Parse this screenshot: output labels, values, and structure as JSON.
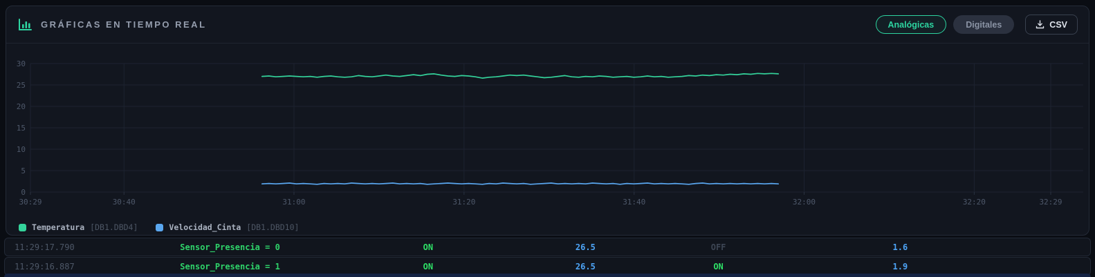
{
  "header": {
    "title": "GRÁFICAS EN TIEMPO REAL",
    "analog_button": "Analógicas",
    "digital_button": "Digitales",
    "csv_button": "CSV"
  },
  "colors": {
    "accent_green": "#2dd4a0",
    "line_green": "#34d39b",
    "line_blue": "#5aa7f0",
    "grid": "#1d2330",
    "axis_text": "#4e586a",
    "value_blue": "#4da3f5",
    "state_green": "#2ee066",
    "state_off": "#3d4654"
  },
  "chart_data": {
    "type": "line",
    "title": "",
    "xlabel": "",
    "ylabel": "",
    "ylim": [
      0,
      30
    ],
    "y_ticks": [
      0,
      5,
      10,
      15,
      20,
      25,
      30
    ],
    "x_ticks": [
      "30:29",
      "30:40",
      "31:00",
      "31:20",
      "31:40",
      "32:00",
      "32:20",
      "32:29"
    ],
    "x_tick_fracs": [
      0,
      0.0917,
      0.2583,
      0.425,
      0.5917,
      0.7583,
      0.925,
      1.0
    ],
    "grid": true,
    "legend_position": "bottom-left",
    "series": [
      {
        "name": "Temperatura",
        "tag": "[DB1.DBD4]",
        "color": "#34d39b",
        "start_frac": 0.227,
        "end_frac": 0.733,
        "values": [
          27.0,
          27.1,
          26.9,
          27.0,
          27.1,
          27.0,
          26.9,
          27.0,
          26.8,
          27.0,
          27.1,
          26.9,
          26.8,
          26.9,
          27.2,
          27.0,
          26.9,
          27.1,
          27.3,
          27.1,
          27.0,
          27.2,
          27.4,
          27.2,
          27.5,
          27.6,
          27.3,
          27.1,
          27.0,
          27.2,
          27.1,
          26.9,
          26.6,
          26.8,
          26.9,
          27.1,
          27.3,
          27.2,
          27.3,
          27.1,
          26.9,
          26.7,
          26.8,
          27.0,
          27.2,
          26.9,
          26.8,
          27.0,
          26.9,
          27.1,
          27.0,
          26.8,
          26.9,
          27.0,
          26.8,
          26.9,
          27.1,
          26.9,
          27.0,
          26.8,
          26.9,
          27.0,
          27.2,
          27.1,
          27.3,
          27.2,
          27.4,
          27.3,
          27.5,
          27.4,
          27.6,
          27.5,
          27.7,
          27.6,
          27.7,
          27.6
        ]
      },
      {
        "name": "Velocidad_Cinta",
        "tag": "[DB1.DBD10]",
        "color": "#5aa7f0",
        "start_frac": 0.227,
        "end_frac": 0.733,
        "values": [
          1.9,
          2.0,
          1.9,
          2.0,
          2.1,
          1.9,
          2.0,
          1.9,
          1.8,
          2.0,
          1.9,
          2.0,
          1.9,
          2.1,
          2.0,
          1.9,
          2.0,
          1.9,
          2.0,
          2.1,
          1.9,
          2.0,
          1.9,
          2.0,
          1.8,
          1.9,
          2.0,
          2.1,
          2.0,
          1.9,
          2.0,
          1.9,
          1.8,
          2.0,
          1.9,
          2.1,
          2.0,
          1.9,
          2.0,
          1.8,
          1.9,
          2.0,
          2.1,
          1.9,
          2.0,
          1.9,
          2.0,
          1.9,
          2.1,
          2.0,
          1.9,
          2.0,
          1.8,
          2.0,
          1.9,
          2.0,
          2.1,
          1.9,
          2.0,
          1.9,
          2.0,
          1.9,
          1.8,
          2.0,
          2.1,
          1.9,
          2.0,
          1.9,
          2.0,
          1.9,
          2.0,
          1.9,
          2.0,
          1.9,
          2.0,
          1.9
        ]
      }
    ]
  },
  "log": {
    "rows": [
      {
        "cells": [
          {
            "t": "11:29:17.790",
            "s": "time"
          },
          {
            "t": "Sensor_Presencia = 0",
            "s": "event"
          },
          {
            "t": "ON",
            "s": "on"
          },
          {
            "t": "26.5",
            "s": "num"
          },
          {
            "t": "OFF",
            "s": "off"
          },
          {
            "t": "1.6",
            "s": "num"
          }
        ]
      },
      {
        "cells": [
          {
            "t": "11:29:16.887",
            "s": "time"
          },
          {
            "t": "Sensor_Presencia = 1",
            "s": "event"
          },
          {
            "t": "ON",
            "s": "on"
          },
          {
            "t": "26.5",
            "s": "num"
          },
          {
            "t": "ON",
            "s": "on"
          },
          {
            "t": "1.9",
            "s": "num"
          }
        ]
      }
    ]
  }
}
